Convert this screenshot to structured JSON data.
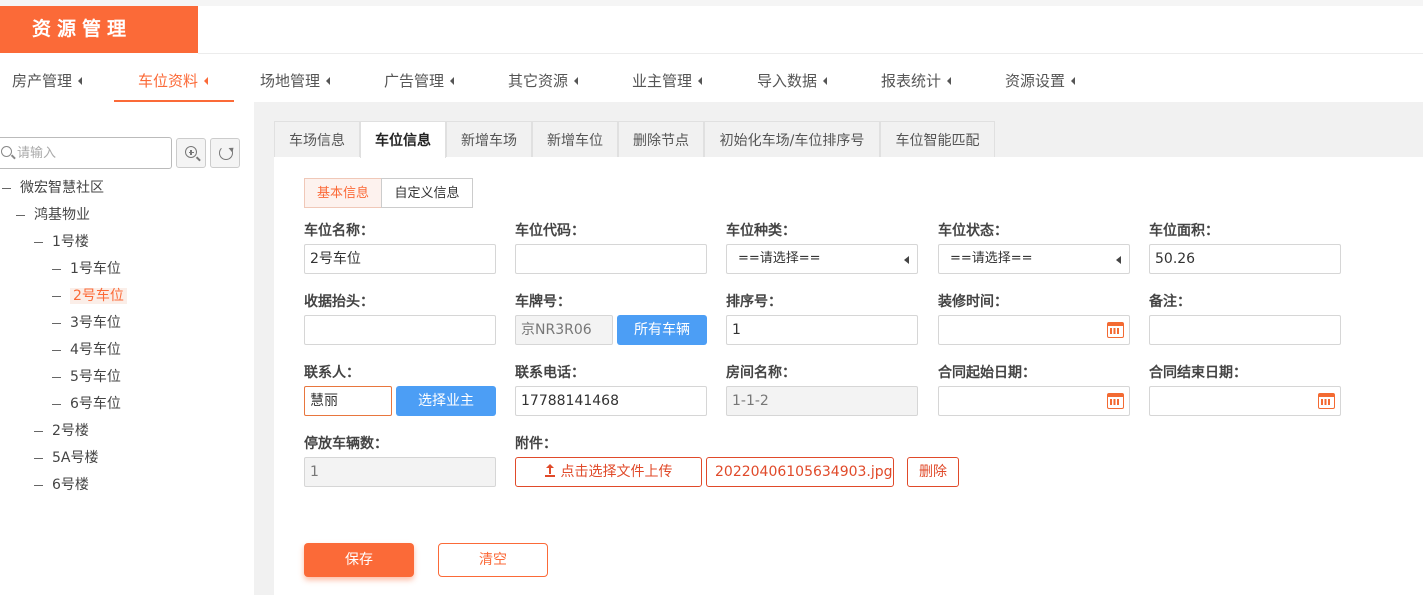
{
  "header": {
    "title": "资源管理"
  },
  "topnav": {
    "items": [
      {
        "label": "房产管理"
      },
      {
        "label": "车位资料"
      },
      {
        "label": "场地管理"
      },
      {
        "label": "广告管理"
      },
      {
        "label": "其它资源"
      },
      {
        "label": "业主管理"
      },
      {
        "label": "导入数据"
      },
      {
        "label": "报表统计"
      },
      {
        "label": "资源设置"
      }
    ],
    "active": "车位资料"
  },
  "sidebar": {
    "search_placeholder": "请输入",
    "tree": [
      {
        "label": "微宏智慧社区"
      },
      {
        "label": "鸿基物业"
      },
      {
        "label": "1号楼"
      },
      {
        "label": "1号车位"
      },
      {
        "label": "2号车位"
      },
      {
        "label": "3号车位"
      },
      {
        "label": "4号车位"
      },
      {
        "label": "5号车位"
      },
      {
        "label": "6号车位"
      },
      {
        "label": "2号楼"
      },
      {
        "label": "5A号楼"
      },
      {
        "label": "6号楼"
      }
    ],
    "selected": "2号车位"
  },
  "tabs": [
    {
      "label": "车场信息"
    },
    {
      "label": "车位信息"
    },
    {
      "label": "新增车场"
    },
    {
      "label": "新增车位"
    },
    {
      "label": "删除节点"
    },
    {
      "label": "初始化车场/车位排序号"
    },
    {
      "label": "车位智能匹配"
    }
  ],
  "active_tab": "车位信息",
  "subtabs": [
    {
      "label": "基本信息"
    },
    {
      "label": "自定义信息"
    }
  ],
  "form": {
    "space_name": {
      "label": "车位名称：",
      "value": "2号车位"
    },
    "space_code": {
      "label": "车位代码：",
      "value": ""
    },
    "space_type": {
      "label": "车位种类：",
      "value": "==请选择=="
    },
    "space_status": {
      "label": "车位状态：",
      "value": "==请选择=="
    },
    "space_area": {
      "label": "车位面积：",
      "value": "50.26"
    },
    "receipt_header": {
      "label": "收据抬头：",
      "value": ""
    },
    "plate_number": {
      "label": "车牌号：",
      "value": "京NR3R06",
      "button": "所有车辆"
    },
    "sort_number": {
      "label": "排序号：",
      "value": "1"
    },
    "decoration_time": {
      "label": "装修时间：",
      "value": ""
    },
    "remark": {
      "label": "备注：",
      "value": ""
    },
    "contact": {
      "label": "联系人：",
      "value": "慧丽",
      "button": "选择业主"
    },
    "contact_phone": {
      "label": "联系电话：",
      "value": "17788141468"
    },
    "room_name": {
      "label": "房间名称：",
      "value": "1-1-2"
    },
    "contract_start": {
      "label": "合同起始日期：",
      "value": ""
    },
    "contract_end": {
      "label": "合同结束日期：",
      "value": ""
    },
    "parked_count": {
      "label": "停放车辆数：",
      "value": "1"
    },
    "attachment": {
      "label": "附件：",
      "upload_label": "点击选择文件上传",
      "file_name": "20220406105634903.jpg",
      "delete_label": "删除"
    }
  },
  "actions": {
    "save": "保存",
    "clear": "清空"
  },
  "colors": {
    "accent": "#fb6a38",
    "blue": "#4c9ef5"
  }
}
